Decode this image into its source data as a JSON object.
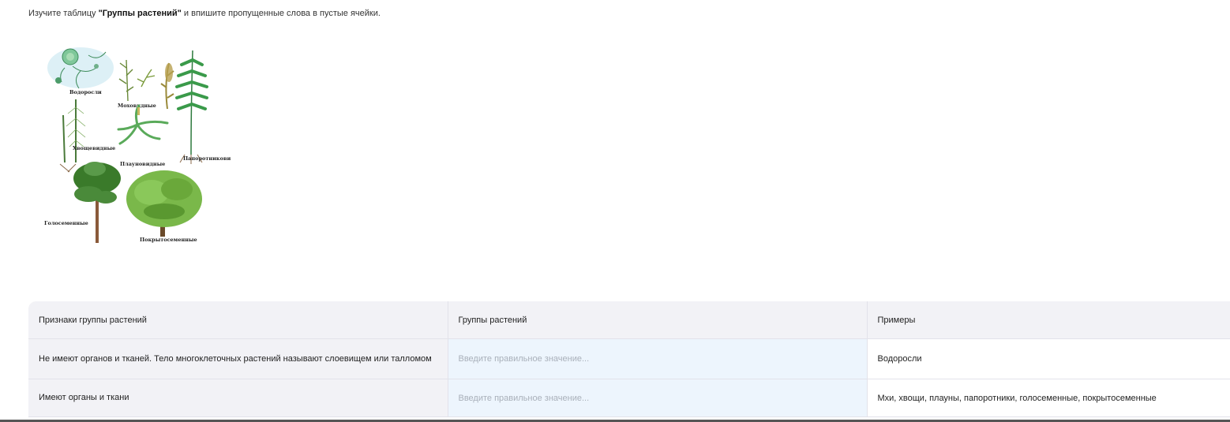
{
  "instruction": {
    "prefix": "Изучите таблицу ",
    "bold": "\"Группы растений\"",
    "suffix": " и впишите пропущенные слова в пустые ячейки."
  },
  "figure": {
    "labels": {
      "algae": "Водоросли",
      "mosses": "Моховидные",
      "horsetails": "Хвощевидные",
      "clubmosses": "Плауновидные",
      "ferns": "Папоротниковидные",
      "gymnosperms": "Голосеменные",
      "angiosperms": "Покрытосеменные"
    }
  },
  "table": {
    "headers": [
      "Признаки группы растений",
      "Группы растений",
      "Примеры"
    ],
    "rows": [
      {
        "feature": "Не имеют органов и тканей. Тело многоклеточных растений называют слоевищем или талломом",
        "answer_value": "",
        "answer_placeholder": "Введите правильное значение...",
        "examples": "Водоросли"
      },
      {
        "feature": "Имеют органы и ткани",
        "answer_value": "",
        "answer_placeholder": "Введите правильное значение...",
        "examples": "Мхи, хвощи, плауны, папоротники, голосеменные, покрытосеменные"
      }
    ]
  },
  "colors": {
    "header_bg": "#f2f2f6",
    "input_bg": "#edf5fd",
    "placeholder": "#a9b0ba"
  }
}
